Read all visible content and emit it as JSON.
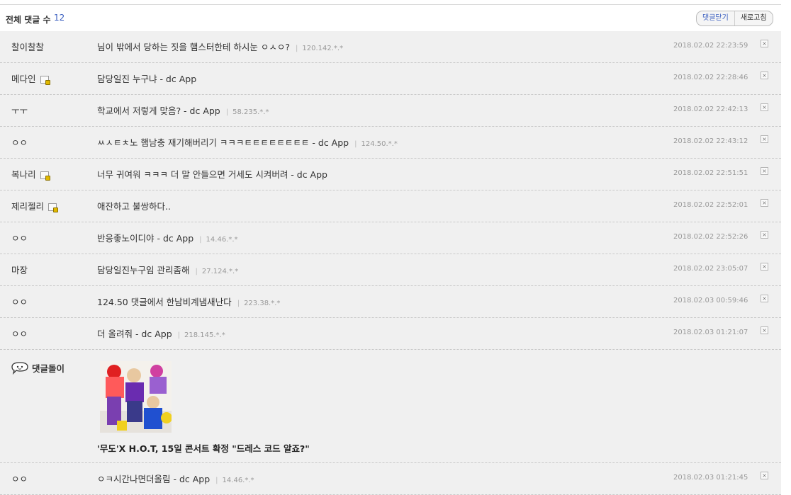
{
  "header": {
    "title": "전체 댓글 수",
    "count": "12",
    "close_label": "댓글닫기",
    "refresh_label": "새로고침"
  },
  "comments": [
    {
      "nick": "찰이찰찰",
      "text": "님이 밖에서 당하는 짓을 햄스터한테 하시눈 ㅇㅅㅇ?",
      "ip": "120.142.*.*",
      "date": "2018.02.02 22:23:59",
      "icon": false
    },
    {
      "nick": "메다인",
      "text": "담당일진 누구냐 - dc App",
      "ip": "",
      "date": "2018.02.02 22:28:46",
      "icon": true
    },
    {
      "nick": "ㅜㅜ",
      "text": "학교에서 저렇게 맞음? - dc App",
      "ip": "58.235.*.*",
      "date": "2018.02.02 22:42:13",
      "icon": false
    },
    {
      "nick": "ㅇㅇ",
      "text": "ㅆㅅㅌㅊ노 햄남충 재기해버리기 ㅋㅋㅋㅌㅌㅌㅌㅌㅌㅌㅌ - dc App",
      "ip": "124.50.*.*",
      "date": "2018.02.02 22:43:12",
      "icon": false
    },
    {
      "nick": "복나리",
      "text": "너무 귀여워 ㅋㅋㅋ 더 말 안들으면 거세도 시켜버려 - dc App",
      "ip": "",
      "date": "2018.02.02 22:51:51",
      "icon": true
    },
    {
      "nick": "제리젤리",
      "text": "애잔하고 불쌍하다..",
      "ip": "",
      "date": "2018.02.02 22:52:01",
      "icon": true
    },
    {
      "nick": "ㅇㅇ",
      "text": "반응좋노이디야 - dc App",
      "ip": "14.46.*.*",
      "date": "2018.02.02 22:52:26",
      "icon": false
    },
    {
      "nick": "마장",
      "text": "담당일진누구임 관리좀해",
      "ip": "27.124.*.*",
      "date": "2018.02.02 23:05:07",
      "icon": false
    },
    {
      "nick": "ㅇㅇ",
      "text": "124.50 댓글에서 한남비계냄새난다",
      "ip": "223.38.*.*",
      "date": "2018.02.03 00:59:46",
      "icon": false
    },
    {
      "nick": "ㅇㅇ",
      "text": "더 올려줘 - dc App",
      "ip": "218.145.*.*",
      "date": "2018.02.03 01:21:07",
      "icon": false
    }
  ],
  "bot": {
    "nick": "댓글돌이",
    "icon": "speech-bubble-face-icon",
    "news_title": "'무도'X H.O.T, 15일 콘서트 확정 \"드레스 코드 알죠?\""
  },
  "last_comment": {
    "nick": "ㅇㅇ",
    "text": "ㅇㅋ시간나면더올림 - dc App",
    "ip": "14.46.*.*",
    "date": "2018.02.03 01:21:45"
  },
  "colors": {
    "row_bg": "#f0f0f0",
    "count_blue": "#3b5fc0",
    "meta_gray": "#999999"
  }
}
